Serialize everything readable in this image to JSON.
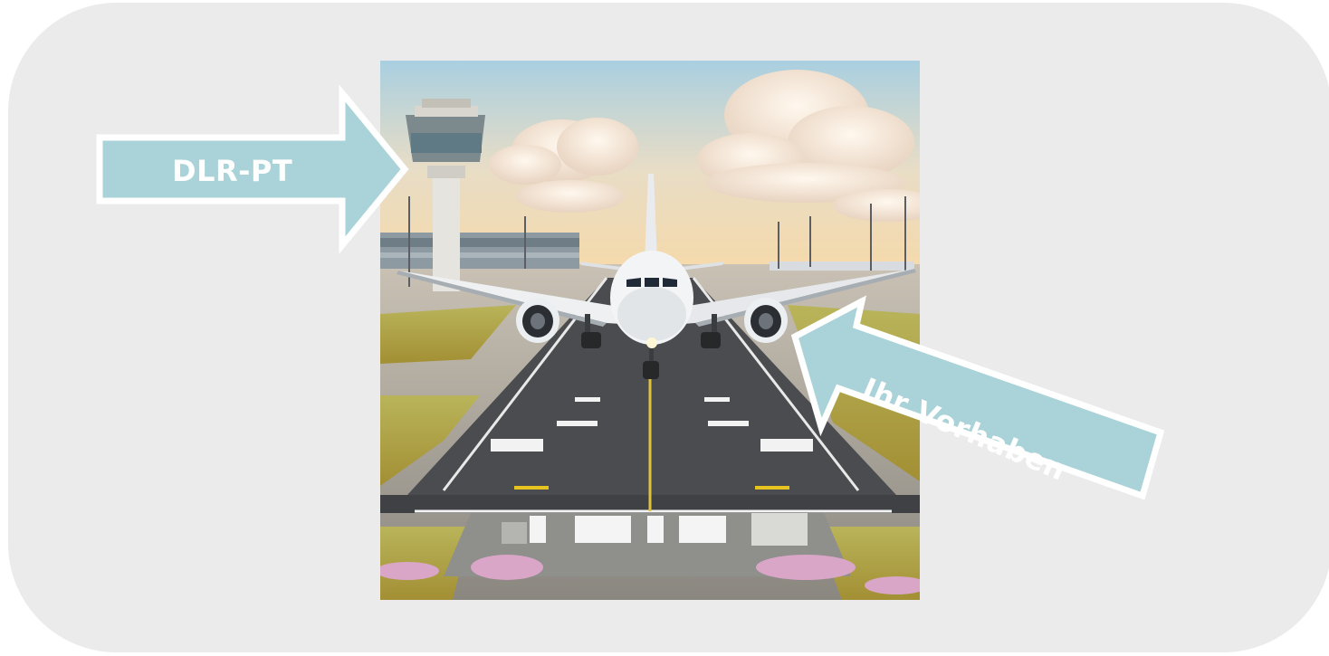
{
  "arrows": {
    "dlr_pt": "DLR-PT",
    "ihr_vorhaben": "Ihr Vorhaben"
  },
  "colors": {
    "arrow_fill": "#a9d3d9",
    "arrow_stroke": "#ffffff",
    "panel_bg": "#ebebeb"
  },
  "image": {
    "subject": "airplane-on-runway-illustration"
  }
}
